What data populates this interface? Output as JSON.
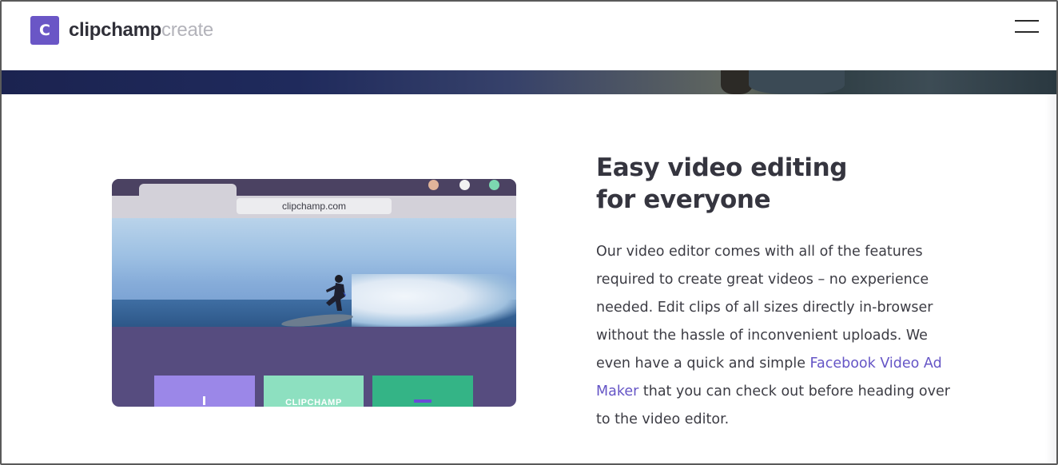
{
  "header": {
    "logo_badge": "C",
    "logo_main": "clipchamp",
    "logo_sub": "create",
    "menu_icon": "hamburger-icon"
  },
  "illustration": {
    "address": "clipchamp.com",
    "panel_label": "CLIPCHAMP"
  },
  "content": {
    "heading_line1": "Easy video editing",
    "heading_line2": "for everyone",
    "para_before_link": "Our video editor comes with all of the features required to create great videos – no experience needed. Edit clips of all sizes directly in-browser without the hassle of inconvenient uploads. We even have a quick and simple ",
    "link_text": "Facebook Video Ad Maker",
    "para_after_link": " that you can check out before heading over to the video editor."
  },
  "colors": {
    "brand": "#6a56c6",
    "link": "#6555c6",
    "panel_purple": "#9b87e8",
    "panel_mint": "#8de0c0",
    "panel_green": "#34b486"
  }
}
